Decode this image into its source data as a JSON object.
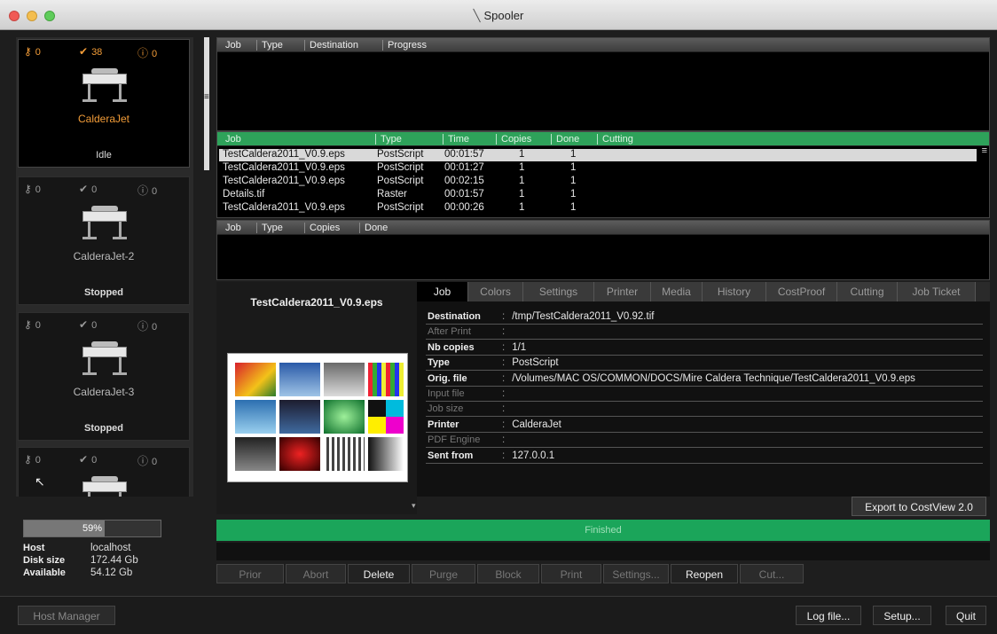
{
  "window": {
    "title": "Spooler"
  },
  "printers": [
    {
      "name": "CalderaJet",
      "state": "Idle",
      "keys": "0",
      "done": "38",
      "errors": "0",
      "selected": true
    },
    {
      "name": "CalderaJet-2",
      "state": "Stopped",
      "keys": "0",
      "done": "0",
      "errors": "0",
      "selected": false
    },
    {
      "name": "CalderaJet-3",
      "state": "Stopped",
      "keys": "0",
      "done": "0",
      "errors": "0",
      "selected": false
    },
    {
      "name": "",
      "state": "",
      "keys": "0",
      "done": "0",
      "errors": "0",
      "selected": false
    }
  ],
  "queue_table": {
    "headers": [
      "Job",
      "Type",
      "Destination",
      "Progress"
    ]
  },
  "done_table": {
    "headers": [
      "Job",
      "Type",
      "Time",
      "Copies",
      "Done",
      "Cutting"
    ],
    "rows": [
      [
        "TestCaldera2011_V0.9.eps",
        "PostScript",
        "00:01:57",
        "1",
        "1",
        ""
      ],
      [
        "TestCaldera2011_V0.9.eps",
        "PostScript",
        "00:01:27",
        "1",
        "1",
        ""
      ],
      [
        "TestCaldera2011_V0.9.eps",
        "PostScript",
        "00:02:15",
        "1",
        "1",
        ""
      ],
      [
        "Details.tif",
        "Raster",
        "00:01:57",
        "1",
        "1",
        ""
      ],
      [
        "TestCaldera2011_V0.9.eps",
        "PostScript",
        "00:00:26",
        "1",
        "1",
        ""
      ]
    ]
  },
  "copies_table": {
    "headers": [
      "Job",
      "Type",
      "Copies",
      "Done"
    ]
  },
  "preview": {
    "title": "TestCaldera2011_V0.9.eps"
  },
  "tabs": [
    "Job",
    "Colors",
    "Settings",
    "Printer",
    "Media",
    "History",
    "CostProof",
    "Cutting",
    "Job Ticket"
  ],
  "details": [
    {
      "label": "Destination",
      "value": "/tmp/TestCaldera2011_V0.92.tif",
      "dim": false
    },
    {
      "label": "After Print",
      "value": "",
      "dim": true
    },
    {
      "label": "Nb copies",
      "value": "1/1",
      "dim": false
    },
    {
      "label": "Type",
      "value": "PostScript",
      "dim": false
    },
    {
      "label": "Orig. file",
      "value": "/Volumes/MAC OS/COMMON/DOCS/Mire Caldera Technique/TestCaldera2011_V0.9.eps",
      "dim": false
    },
    {
      "label": "Input file",
      "value": "",
      "dim": true
    },
    {
      "label": "Job size",
      "value": "",
      "dim": true
    },
    {
      "label": "Printer",
      "value": "CalderaJet",
      "dim": false
    },
    {
      "label": "PDF Engine",
      "value": "",
      "dim": true
    },
    {
      "label": "Sent from",
      "value": "127.0.0.1",
      "dim": false
    }
  ],
  "export_button": "Export to CostView 2.0",
  "status_bar": "Finished",
  "action_buttons": [
    {
      "label": "Prior",
      "enabled": false
    },
    {
      "label": "Abort",
      "enabled": false
    },
    {
      "label": "Delete",
      "enabled": true
    },
    {
      "label": "Purge",
      "enabled": false
    },
    {
      "label": "Block",
      "enabled": false
    },
    {
      "label": "Print",
      "enabled": false
    },
    {
      "label": "Settings...",
      "enabled": false
    },
    {
      "label": "Reopen",
      "enabled": true
    },
    {
      "label": "Cut...",
      "enabled": false
    }
  ],
  "host": {
    "disk_percent": "59%",
    "disk_fraction": 0.59,
    "host_label": "Host",
    "host_value": "localhost",
    "size_label": "Disk size",
    "size_value": "172.44 Gb",
    "avail_label": "Available",
    "avail_value": "54.12 Gb"
  },
  "bottom_buttons": {
    "host_manager": "Host Manager",
    "log": "Log file...",
    "setup": "Setup...",
    "quit": "Quit"
  },
  "colors": {
    "accent_green": "#1ba55a",
    "accent_orange": "#f29c38"
  }
}
